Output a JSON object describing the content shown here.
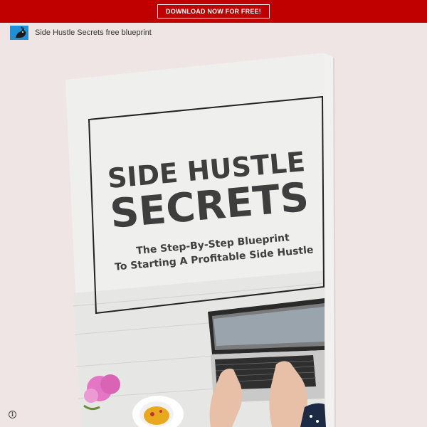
{
  "top_bar": {
    "cta_label": "DOWNLOAD NOW FOR FREE!",
    "background": "#c00000"
  },
  "header": {
    "title": "Side Hustle Secrets free blueprint",
    "avatar_icon": "rabbit-logo-icon"
  },
  "book": {
    "title_line1": "SIDE HUSTLE",
    "title_line2": "SECRETS",
    "subtitle_line1": "The Step-By-Step Blueprint",
    "subtitle_line2": "To Starting A Profitable Side Hustle"
  },
  "footer": {
    "info_icon": "info-icon",
    "info_glyph": "i"
  }
}
